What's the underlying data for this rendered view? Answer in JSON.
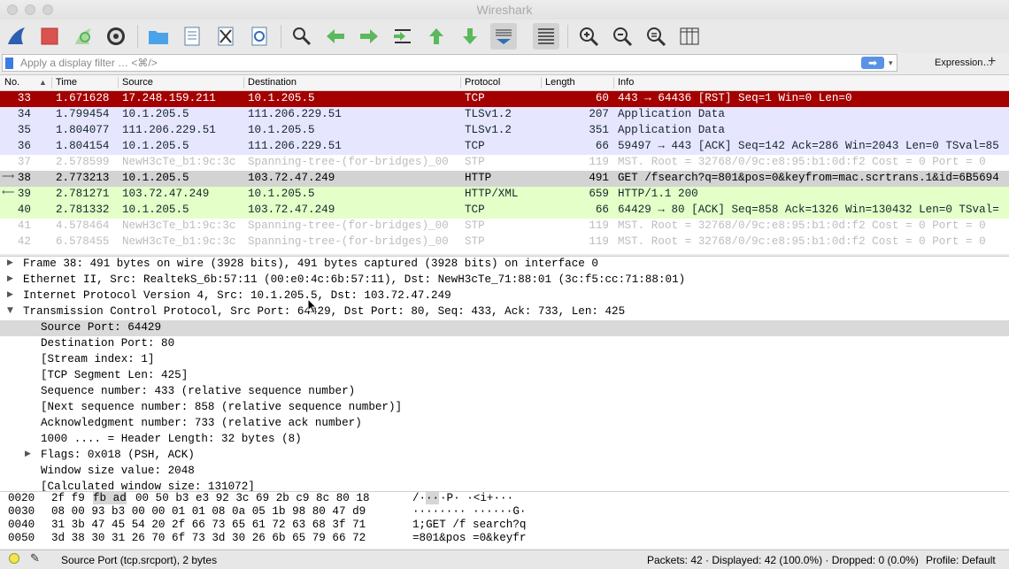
{
  "window": {
    "title": "Wireshark"
  },
  "filter": {
    "placeholder": "Apply a display filter … <⌘/>",
    "arrow": "➡",
    "dropdown": "▾",
    "expression_label": "Expression…",
    "plus": "+"
  },
  "toolbar": {
    "icons": [
      "shark-fin-start-icon",
      "stop-icon",
      "restart-icon",
      "options-gear-icon",
      "open-folder-icon",
      "file-icon",
      "close-file-icon",
      "reload-icon",
      "find-icon",
      "back-arrow-icon",
      "forward-arrow-icon",
      "goto-packet-icon",
      "first-packet-icon",
      "last-packet-icon",
      "autoscroll-icon",
      "colorize-icon",
      "zoom-in-icon",
      "zoom-out-icon",
      "zoom-normal-icon",
      "resize-columns-icon"
    ]
  },
  "columns": {
    "no": "No.",
    "time": "Time",
    "source": "Source",
    "destination": "Destination",
    "protocol": "Protocol",
    "length": "Length",
    "info": "Info"
  },
  "packets": [
    {
      "no": "33",
      "time": "1.671628",
      "src": "17.248.159.211",
      "dst": "10.1.205.5",
      "proto": "TCP",
      "len": "60",
      "info": "443 → 64436 [RST] Seq=1 Win=0 Len=0",
      "style": "red"
    },
    {
      "no": "34",
      "time": "1.799454",
      "src": "10.1.205.5",
      "dst": "111.206.229.51",
      "proto": "TLSv1.2",
      "len": "207",
      "info": "Application Data",
      "style": "lav"
    },
    {
      "no": "35",
      "time": "1.804077",
      "src": "111.206.229.51",
      "dst": "10.1.205.5",
      "proto": "TLSv1.2",
      "len": "351",
      "info": "Application Data",
      "style": "lav"
    },
    {
      "no": "36",
      "time": "1.804154",
      "src": "10.1.205.5",
      "dst": "111.206.229.51",
      "proto": "TCP",
      "len": "66",
      "info": "59497 → 443 [ACK] Seq=142 Ack=286 Win=2043 Len=0 TSval=85",
      "style": "lav"
    },
    {
      "no": "37",
      "time": "2.578599",
      "src": "NewH3cTe_b1:9c:3c",
      "dst": "Spanning-tree-(for-bridges)_00",
      "proto": "STP",
      "len": "119",
      "info": "MST. Root = 32768/0/9c:e8:95:b1:0d:f2  Cost = 0  Port = 0",
      "style": "gray"
    },
    {
      "no": "38",
      "time": "2.773213",
      "src": "10.1.205.5",
      "dst": "103.72.47.249",
      "proto": "HTTP",
      "len": "491",
      "info": "GET /fsearch?q=801&pos=0&keyfrom=mac.scrtrans.1&id=6B5694",
      "style": "sel"
    },
    {
      "no": "39",
      "time": "2.781271",
      "src": "103.72.47.249",
      "dst": "10.1.205.5",
      "proto": "HTTP/XML",
      "len": "659",
      "info": "HTTP/1.1 200",
      "style": "green"
    },
    {
      "no": "40",
      "time": "2.781332",
      "src": "10.1.205.5",
      "dst": "103.72.47.249",
      "proto": "TCP",
      "len": "66",
      "info": "64429 → 80 [ACK] Seq=858 Ack=1326 Win=130432 Len=0 TSval=",
      "style": "green"
    },
    {
      "no": "41",
      "time": "4.578464",
      "src": "NewH3cTe_b1:9c:3c",
      "dst": "Spanning-tree-(for-bridges)_00",
      "proto": "STP",
      "len": "119",
      "info": "MST. Root = 32768/0/9c:e8:95:b1:0d:f2  Cost = 0  Port = 0",
      "style": "gray"
    },
    {
      "no": "42",
      "time": "6.578455",
      "src": "NewH3cTe_b1:9c:3c",
      "dst": "Spanning-tree-(for-bridges)_00",
      "proto": "STP",
      "len": "119",
      "info": "MST. Root = 32768/0/9c:e8:95:b1:0d:f2  Cost = 0  Port = 0",
      "style": "gray"
    }
  ],
  "details": [
    {
      "text": "Frame 38: 491 bytes on wire (3928 bits), 491 bytes captured (3928 bits) on interface 0",
      "tri": "▶",
      "indent": 0
    },
    {
      "text": "Ethernet II, Src: RealtekS_6b:57:11 (00:e0:4c:6b:57:11), Dst: NewH3cTe_71:88:01 (3c:f5:cc:71:88:01)",
      "tri": "▶",
      "indent": 0
    },
    {
      "text": "Internet Protocol Version 4, Src: 10.1.205.5, Dst: 103.72.47.249",
      "tri": "▶",
      "indent": 0
    },
    {
      "text": "Transmission Control Protocol, Src Port: 64429, Dst Port: 80, Seq: 433, Ack: 733, Len: 425",
      "tri": "▼",
      "indent": 0
    },
    {
      "text": "Source Port: 64429",
      "tri": "",
      "indent": 1,
      "selected": true
    },
    {
      "text": "Destination Port: 80",
      "tri": "",
      "indent": 1
    },
    {
      "text": "[Stream index: 1]",
      "tri": "",
      "indent": 1
    },
    {
      "text": "[TCP Segment Len: 425]",
      "tri": "",
      "indent": 1
    },
    {
      "text": "Sequence number: 433    (relative sequence number)",
      "tri": "",
      "indent": 1
    },
    {
      "text": "[Next sequence number: 858    (relative sequence number)]",
      "tri": "",
      "indent": 1
    },
    {
      "text": "Acknowledgment number: 733    (relative ack number)",
      "tri": "",
      "indent": 1
    },
    {
      "text": "1000 .... = Header Length: 32 bytes (8)",
      "tri": "",
      "indent": 1
    },
    {
      "text": "Flags: 0x018 (PSH, ACK)",
      "tri": "▶",
      "indent": 1
    },
    {
      "text": "Window size value: 2048",
      "tri": "",
      "indent": 1
    },
    {
      "text": "[Calculated window size: 131072]",
      "tri": "",
      "indent": 1
    }
  ],
  "bytes": [
    {
      "offset": "0020",
      "hex_a": "2f f9",
      "hex_hl": "fb ad",
      "hex_b": "00 50 b3 e3  92 3c 69 2b c9 8c 80 18",
      "ascii_a": "/·",
      "ascii_hl": "··",
      "ascii_b": "·P· ·<i+···"
    },
    {
      "offset": "0030",
      "hex_a": "08 00 93 b3 00 00 01 01  08 0a 05 1b 98 80 47 d9",
      "hex_hl": "",
      "hex_b": "",
      "ascii_a": "········ ······G·",
      "ascii_hl": "",
      "ascii_b": ""
    },
    {
      "offset": "0040",
      "hex_a": "31 3b 47 45 54 20 2f 66  73 65 61 72 63 68 3f 71",
      "hex_hl": "",
      "hex_b": "",
      "ascii_a": "1;GET /f search?q",
      "ascii_hl": "",
      "ascii_b": ""
    },
    {
      "offset": "0050",
      "hex_a": "3d 38 30 31 26 70 6f 73  3d 30 26 6b 65 79 66 72",
      "hex_hl": "",
      "hex_b": "",
      "ascii_a": "=801&pos =0&keyfr",
      "ascii_hl": "",
      "ascii_b": ""
    }
  ],
  "status": {
    "field": "Source Port (tcp.srcport), 2 bytes",
    "packets": "Packets: 42 · Displayed: 42 (100.0%) · Dropped: 0 (0.0%)",
    "profile": "Profile: Default"
  },
  "colors": {
    "red_row": "#a40000",
    "lavender_row": "#e7e6ff",
    "green_row": "#e4ffc7",
    "selected_row": "#d3d3d3"
  }
}
